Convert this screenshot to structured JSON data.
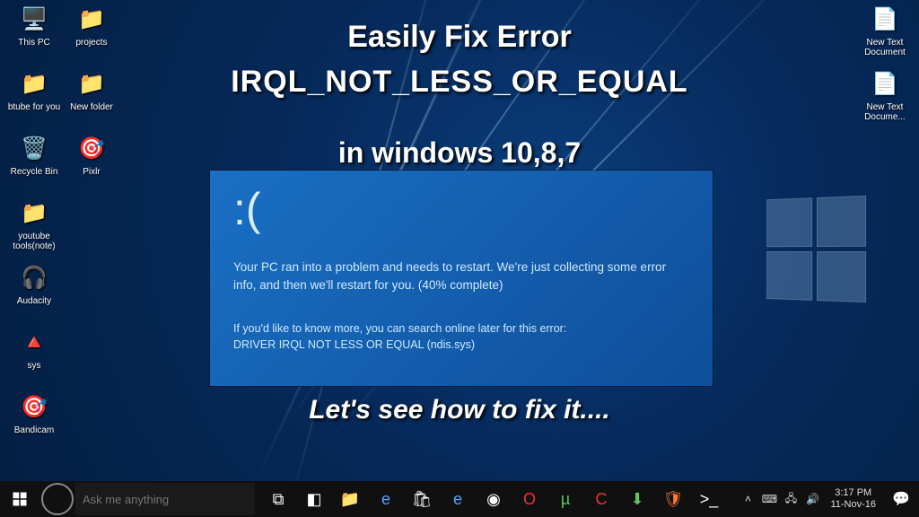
{
  "overlay": {
    "line1": "Easily Fix Error",
    "line2": "IRQL_NOT_LESS_OR_EQUAL",
    "line3": "in windows 10,8,7",
    "line4": "Let's see how to fix it...."
  },
  "bsod": {
    "face": ":(",
    "message": "Your PC ran into a problem and needs to restart. We're just collecting some error info, and then we'll restart for you. (40% complete)",
    "more1": "If you'd like to know more, you can search online later for this error:",
    "more2": "DRIVER IRQL NOT LESS OR EQUAL (ndis.sys)"
  },
  "desktop_icons_left": [
    {
      "label": "This PC",
      "glyph": "🖥️"
    },
    {
      "label": "projects",
      "glyph": "📁"
    },
    {
      "label": "btube for you",
      "glyph": "📁"
    },
    {
      "label": "New folder",
      "glyph": "📁"
    },
    {
      "label": "Recycle Bin",
      "glyph": "🗑️"
    },
    {
      "label": "Pixlr",
      "glyph": "🎯"
    },
    {
      "label": "youtube tools(note)",
      "glyph": "📁"
    },
    {
      "label": "",
      "glyph": ""
    },
    {
      "label": "Audacity",
      "glyph": "🎧"
    },
    {
      "label": "",
      "glyph": ""
    },
    {
      "label": "sys",
      "glyph": "🔺"
    },
    {
      "label": "",
      "glyph": ""
    },
    {
      "label": "Bandicam",
      "glyph": "🎯"
    }
  ],
  "desktop_icons_right": [
    {
      "label": "New Text Document",
      "glyph": "📄"
    },
    {
      "label": "New Text Docume...",
      "glyph": "📄"
    }
  ],
  "taskbar": {
    "search_placeholder": "Ask me anything",
    "pinned": [
      {
        "name": "task-view-icon",
        "glyph": "⧉",
        "cls": "c-white"
      },
      {
        "name": "software-center-icon",
        "glyph": "◧",
        "cls": "c-white"
      },
      {
        "name": "file-explorer-icon",
        "glyph": "📁",
        "cls": "c-yellow"
      },
      {
        "name": "edge-browser-icon",
        "glyph": "e",
        "cls": "c-blue"
      },
      {
        "name": "store-icon",
        "glyph": "🛍",
        "cls": "c-white"
      },
      {
        "name": "ie-browser-icon",
        "glyph": "e",
        "cls": "c-blue"
      },
      {
        "name": "chrome-browser-icon",
        "glyph": "◉",
        "cls": "c-white"
      },
      {
        "name": "opera-browser-icon",
        "glyph": "O",
        "cls": "c-red"
      },
      {
        "name": "utorrent-icon",
        "glyph": "µ",
        "cls": "c-green"
      },
      {
        "name": "ccleaner-icon",
        "glyph": "C",
        "cls": "c-red"
      },
      {
        "name": "idm-icon",
        "glyph": "⬇",
        "cls": "c-green"
      },
      {
        "name": "brave-browser-icon",
        "glyph": "🛡",
        "cls": "c-orange"
      },
      {
        "name": "terminal-icon",
        "glyph": ">_",
        "cls": "c-white"
      }
    ],
    "tray": [
      {
        "name": "tray-up-icon",
        "glyph": "˄"
      },
      {
        "name": "language-icon",
        "glyph": "⌨"
      },
      {
        "name": "network-icon",
        "glyph": "🖧"
      },
      {
        "name": "volume-icon",
        "glyph": "🔊"
      }
    ],
    "time": "3:17 PM",
    "date": "11-Nov-16"
  }
}
